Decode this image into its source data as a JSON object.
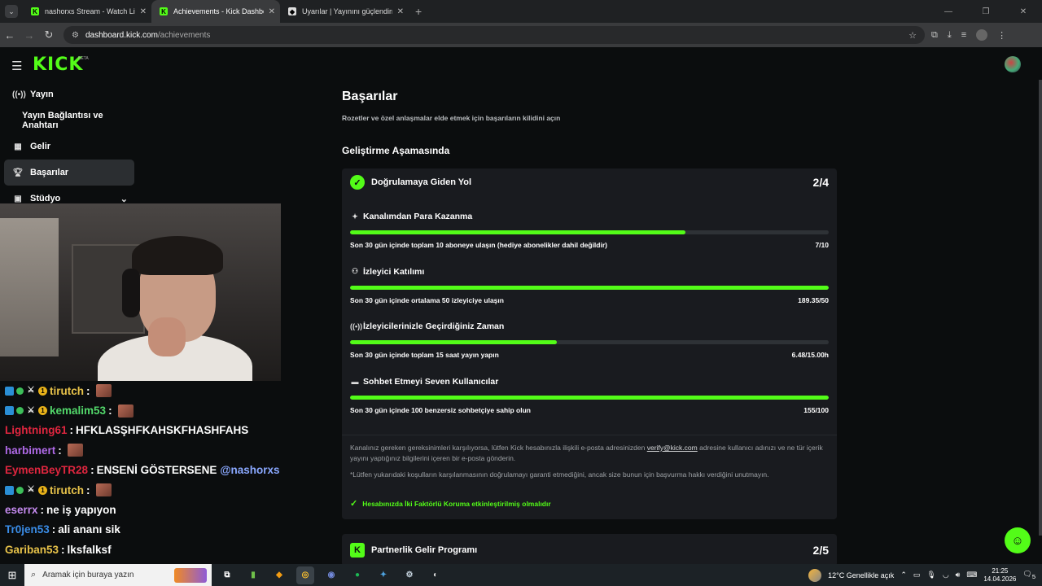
{
  "browser": {
    "tabs": [
      {
        "title": "nashorxs Stream - Watch Live o",
        "active": false
      },
      {
        "title": "Achievements - Kick Dashboard",
        "active": true
      },
      {
        "title": "Uyarılar | Yayınını güçlendirmek",
        "active": false
      }
    ],
    "url_host": "dashboard.kick.com",
    "url_path": "/achievements"
  },
  "brand": {
    "logo": "KICK",
    "beta": "BETA",
    "accent": "#53fc18"
  },
  "sidebar": {
    "items": [
      {
        "label": "Yayın",
        "icon": "broadcast-icon"
      },
      {
        "label": "Yayın Bağlantısı ve Anahtarı",
        "icon": ""
      },
      {
        "label": "Gelir",
        "icon": "chart-icon"
      },
      {
        "label": "Başarılar",
        "icon": "trophy-icon",
        "active": true
      },
      {
        "label": "Stüdyo",
        "icon": "studio-icon"
      }
    ]
  },
  "chat": [
    {
      "user": "tirutch",
      "color": "#e8c34a",
      "badges": true,
      "text": "",
      "emote": true
    },
    {
      "user": "kemalim53",
      "color": "#53d96b",
      "badges": true,
      "text": "",
      "emote": true
    },
    {
      "user": "Lightning61",
      "color": "#e0263f",
      "badges": false,
      "text": "HFKLASŞHFKAHSKFHASHFAHS",
      "emote": false
    },
    {
      "user": "harbimert",
      "color": "#b06ae8",
      "badges": false,
      "text": "",
      "emote": true
    },
    {
      "user": "EymenBeyTR28",
      "color": "#e0263f",
      "badges": false,
      "text": "ENSENİ GÖSTERSENE",
      "mention": "@nashorxs",
      "emote": false
    },
    {
      "user": "tirutch",
      "color": "#e8c34a",
      "badges": true,
      "text": "",
      "emote": true
    },
    {
      "user": "eserrx",
      "color": "#c58bf0",
      "badges": false,
      "text": "ne iş yapıyon",
      "emote": false
    },
    {
      "user": "Tr0jen53",
      "color": "#3a8de8",
      "badges": false,
      "text": "ali ananı sik",
      "emote": false
    },
    {
      "user": "Gariban53",
      "color": "#e8c34a",
      "badges": false,
      "text": "lksfalksf",
      "emote": false
    }
  ],
  "page": {
    "title": "Başarılar",
    "subtitle": "Rozetler ve özel anlaşmalar elde etmek için başarıların kilidini açın",
    "section": "Geliştirme Aşamasında"
  },
  "verification": {
    "title": "Doğrulamaya Giden Yol",
    "count": "2/4",
    "goals": [
      {
        "name": "Kanalımdan Para Kazanma",
        "icon": "sparkle-icon",
        "desc": "Son 30 gün içinde toplam 10 aboneye ulaşın (hediye abonelikler dahil değildir)",
        "value": "7/10",
        "progress": 0.7
      },
      {
        "name": "İzleyici Katılımı",
        "icon": "users-icon",
        "desc": "Son 30 gün içinde ortalama 50 izleyiciye ulaşın",
        "value": "189.35/50",
        "progress": 1.0
      },
      {
        "name": "İzleyicilerinizle Geçirdiğiniz Zaman",
        "icon": "broadcast-icon",
        "desc": "Son 30 gün içinde toplam 15 saat yayın yapın",
        "value": "6.48/15.00h",
        "progress": 0.432
      },
      {
        "name": "Sohbet Etmeyi Seven Kullanıcılar",
        "icon": "chat-icon",
        "desc": "Son 30 gün içinde 100 benzersiz sohbetçiye sahip olun",
        "value": "155/100",
        "progress": 1.0
      }
    ],
    "note_before": "Kanalınız gereken gereksinimleri karşılıyorsa, lütfen Kick hesabınızla ilişkili e-posta adresinizden ",
    "note_link": "verify@kick.com",
    "note_after": " adresine kullanıcı adınızı ve ne tür içerik yayını yaptığınız bilgilerini içeren bir e-posta gönderin.",
    "disclaimer": "*Lütfen yukarıdaki koşulların karşılanmasının doğrulamayı garanti etmediğini, ancak size bunun için başvurma hakkı verdiğini unutmayın.",
    "requirement": "Hesabınızda İki Faktörlü Koruma etkinleştirilmiş olmalıdır"
  },
  "partner": {
    "title": "Partnerlik Gelir Programı",
    "count": "2/5"
  },
  "taskbar": {
    "search_placeholder": "Aramak için buraya yazın",
    "weather": "12°C  Genellikle açık",
    "time": "21:25",
    "date": "14.04.2026",
    "notif": "5"
  }
}
